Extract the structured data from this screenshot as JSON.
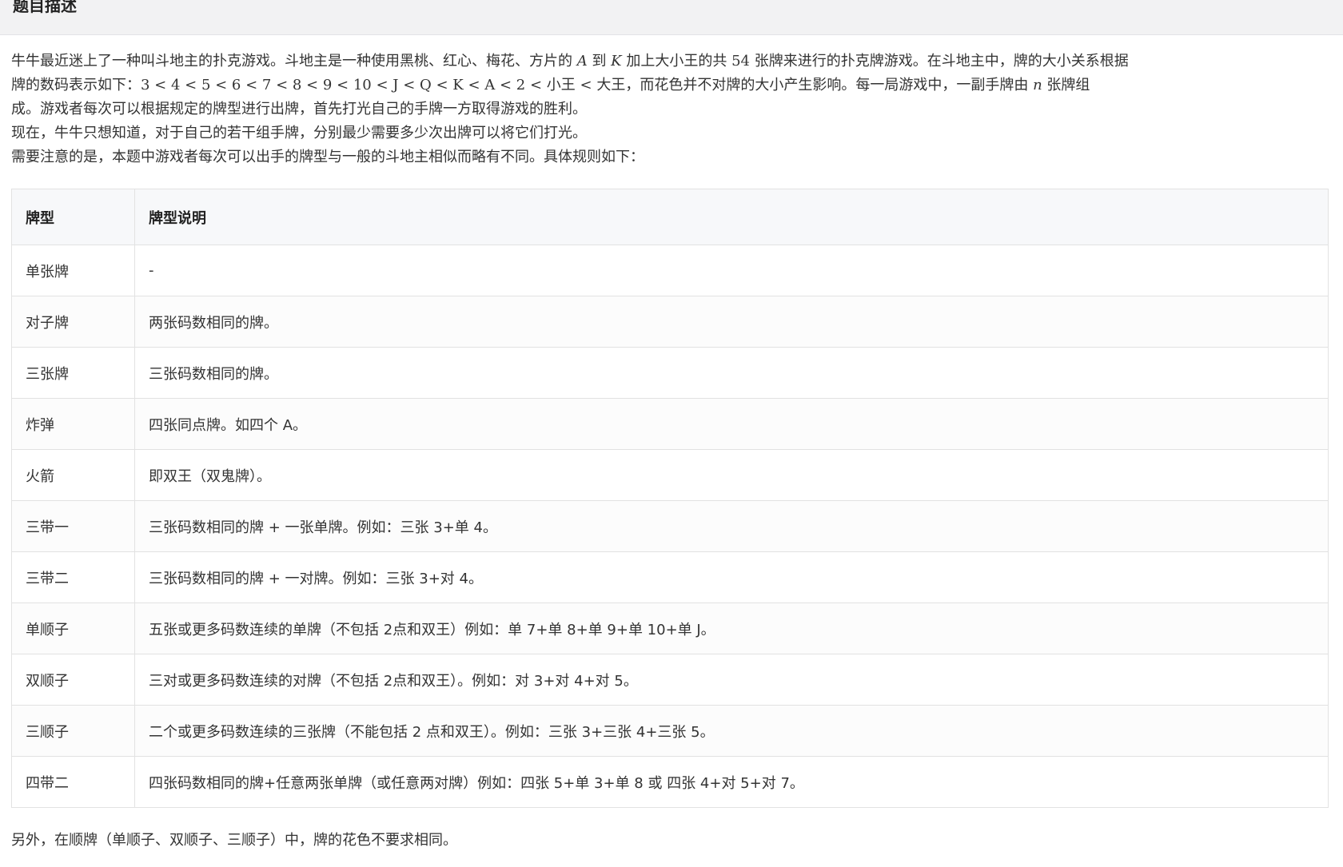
{
  "header": {
    "title": "题目描述"
  },
  "description": {
    "p1": {
      "line1_a": "牛牛最近迷上了一种叫斗地主的扑克游戏。斗地主是一种使用黑桃、红心、梅花、方片的 ",
      "line1_A": "A",
      "line1_to": " 到 ",
      "line1_K": "K",
      "line1_b": " 加上大小王的共 ",
      "line1_54": "54",
      "line1_c": " 张牌来进行的扑克牌游戏。在斗地主中，牌的大小关系根据",
      "line2_a": "牌的数码表示如下：",
      "line2_order": "3 < 4 < 5 < 6 < 7 < 8 < 9 < 10 < J < Q < K < A < 2 <",
      "line2_b": " 小王 ",
      "line2_lt": "<",
      "line2_c": " 大王，而花色并不对牌的大小产生影响。每一局游戏中，一副手牌由 ",
      "line2_n": "n",
      "line2_d": " 张牌组",
      "line3": "成。游戏者每次可以根据规定的牌型进行出牌，首先打光自己的手牌一方取得游戏的胜利。"
    },
    "p2": "现在，牛牛只想知道，对于自己的若干组手牌，分别最少需要多少次出牌可以将它们打光。",
    "p3": "需要注意的是，本题中游戏者每次可以出手的牌型与一般的斗地主相似而略有不同。具体规则如下："
  },
  "table": {
    "headers": [
      "牌型",
      "牌型说明"
    ],
    "rows": [
      {
        "type": "单张牌",
        "desc": "-"
      },
      {
        "type": "对子牌",
        "desc": "两张码数相同的牌。"
      },
      {
        "type": "三张牌",
        "desc": "三张码数相同的牌。"
      },
      {
        "type": "炸弹",
        "desc": "四张同点牌。如四个 A。"
      },
      {
        "type": "火箭",
        "desc": "即双王（双鬼牌）。"
      },
      {
        "type": "三带一",
        "desc": "三张码数相同的牌 + 一张单牌。例如：三张 3+单 4。"
      },
      {
        "type": "三带二",
        "desc": "三张码数相同的牌 + 一对牌。例如：三张 3+对 4。"
      },
      {
        "type": "单顺子",
        "desc": "五张或更多码数连续的单牌（不包括 2点和双王）例如：单 7+单 8+单 9+单 10+单 J。"
      },
      {
        "type": "双顺子",
        "desc": "三对或更多码数连续的对牌（不包括 2点和双王）。例如：对 3+对 4+对 5。"
      },
      {
        "type": "三顺子",
        "desc": "二个或更多码数连续的三张牌（不能包括 2 点和双王）。例如：三张 3+三张 4+三张 5。"
      },
      {
        "type": "四带二",
        "desc": "四张码数相同的牌+任意两张单牌（或任意两对牌）例如：四张 5+单 3+单 8 或 四张 4+对 5+对 7。"
      }
    ]
  },
  "footer": {
    "note": "另外，在顺牌（单顺子、双顺子、三顺子）中，牌的花色不要求相同。"
  }
}
